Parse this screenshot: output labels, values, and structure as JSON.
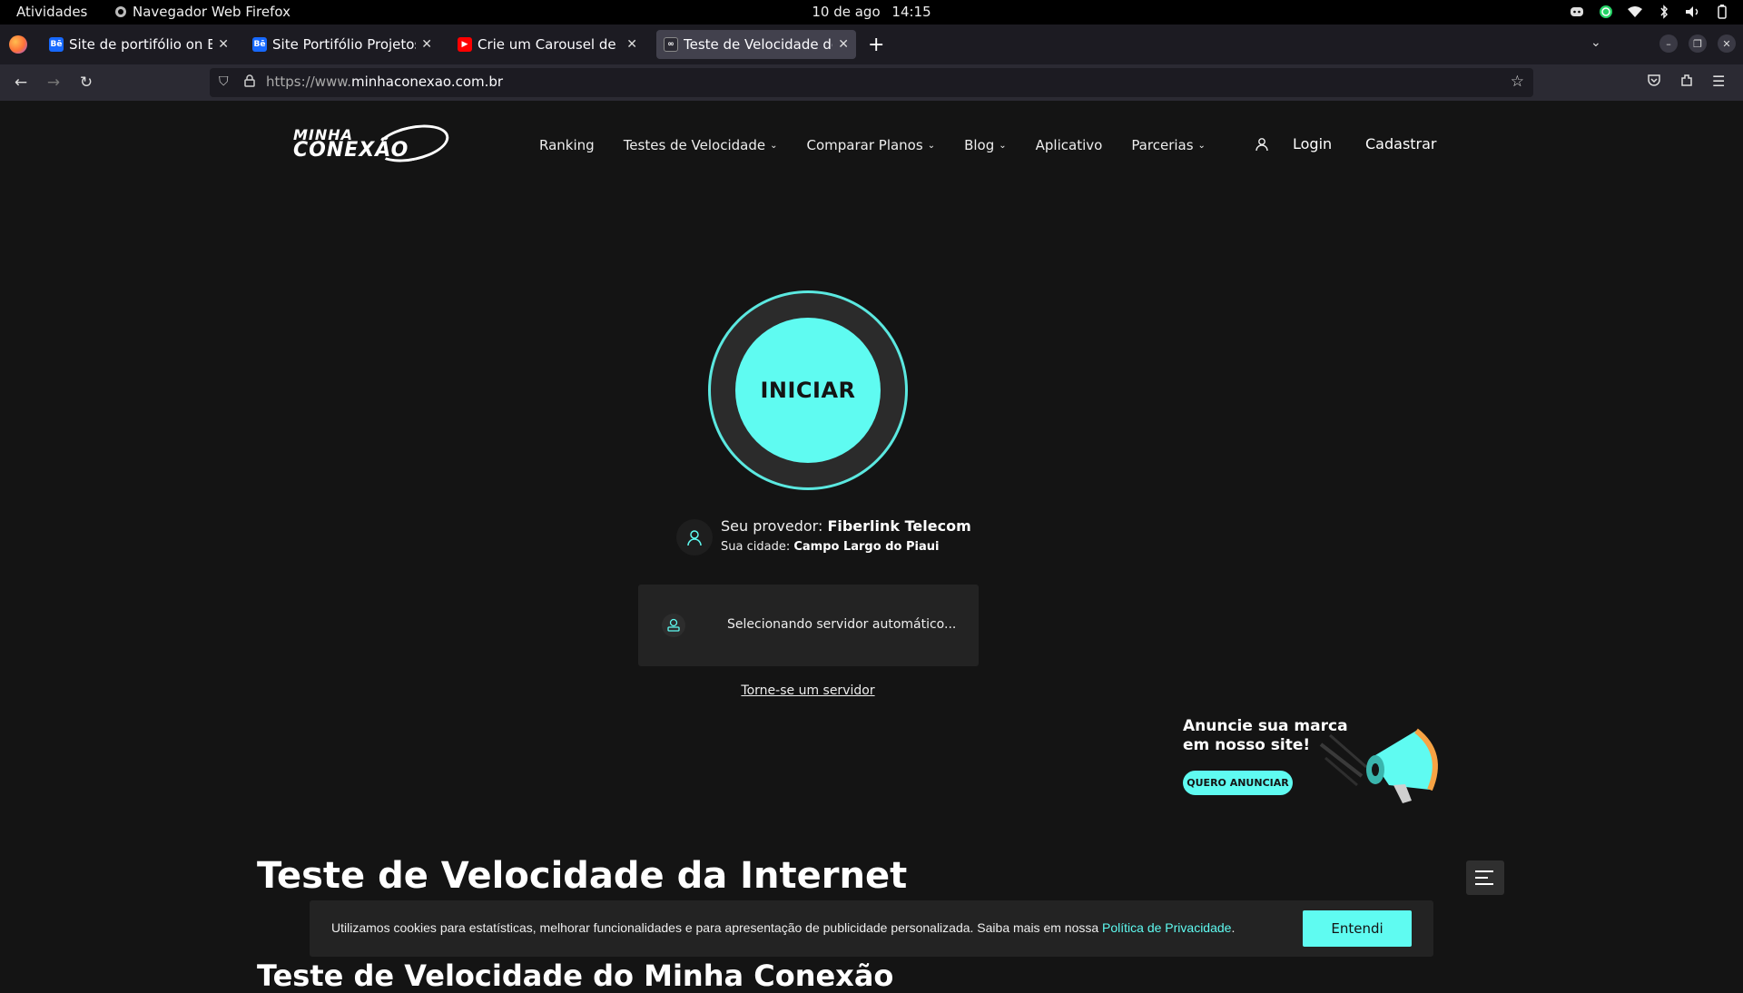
{
  "system_bar": {
    "activities": "Atividades",
    "app_name": "Navegador Web Firefox",
    "date": "10 de ago",
    "time": "14:15"
  },
  "browser": {
    "tabs": [
      {
        "title": "Site de portifólio on Beha",
        "favicon": "behance-icon",
        "active": false
      },
      {
        "title": "Site Portifólio Projetos | P",
        "favicon": "behance-icon",
        "active": false
      },
      {
        "title": "Crie um Carousel de Imag",
        "favicon": "youtube-icon",
        "active": false
      },
      {
        "title": "Teste de Velocidade de In",
        "favicon": "minhaconexao-icon",
        "active": true
      }
    ],
    "url_prefix": "https://www.",
    "url_domain": "minhaconexao.com.br"
  },
  "site": {
    "logo_line1": "MINHA",
    "logo_line2": "CONEXÃO",
    "nav": {
      "ranking": "Ranking",
      "speed_tests": "Testes de Velocidade",
      "compare_plans": "Comparar Planos",
      "blog": "Blog",
      "app": "Aplicativo",
      "partnerships": "Parcerias"
    },
    "login": "Login",
    "signup": "Cadastrar"
  },
  "speedtest": {
    "start_label": "INICIAR",
    "provider_prefix": "Seu provedor:",
    "provider_name": "Fiberlink Telecom",
    "city_prefix": "Sua cidade:",
    "city_name": "Campo Largo do Piaui",
    "server_status": "Selecionando servidor automático...",
    "become_server": "Torne-se um servidor"
  },
  "ad": {
    "title": "Anuncie sua marca em nosso site!",
    "button": "QUERO ANUNCIAR"
  },
  "content": {
    "heading1": "Teste de Velocidade da Internet",
    "heading2": "Teste de Velocidade do Minha Conexão"
  },
  "cookie": {
    "message": "Utilizamos cookies para estatísticas, melhorar funcionalidades e para apresentação de publicidade personalizada. Saiba mais em nossa",
    "link": "Política de Privacidade",
    "period": ".",
    "button": "Entendi"
  },
  "colors": {
    "accent": "#5ffbf1",
    "background": "#141414"
  }
}
